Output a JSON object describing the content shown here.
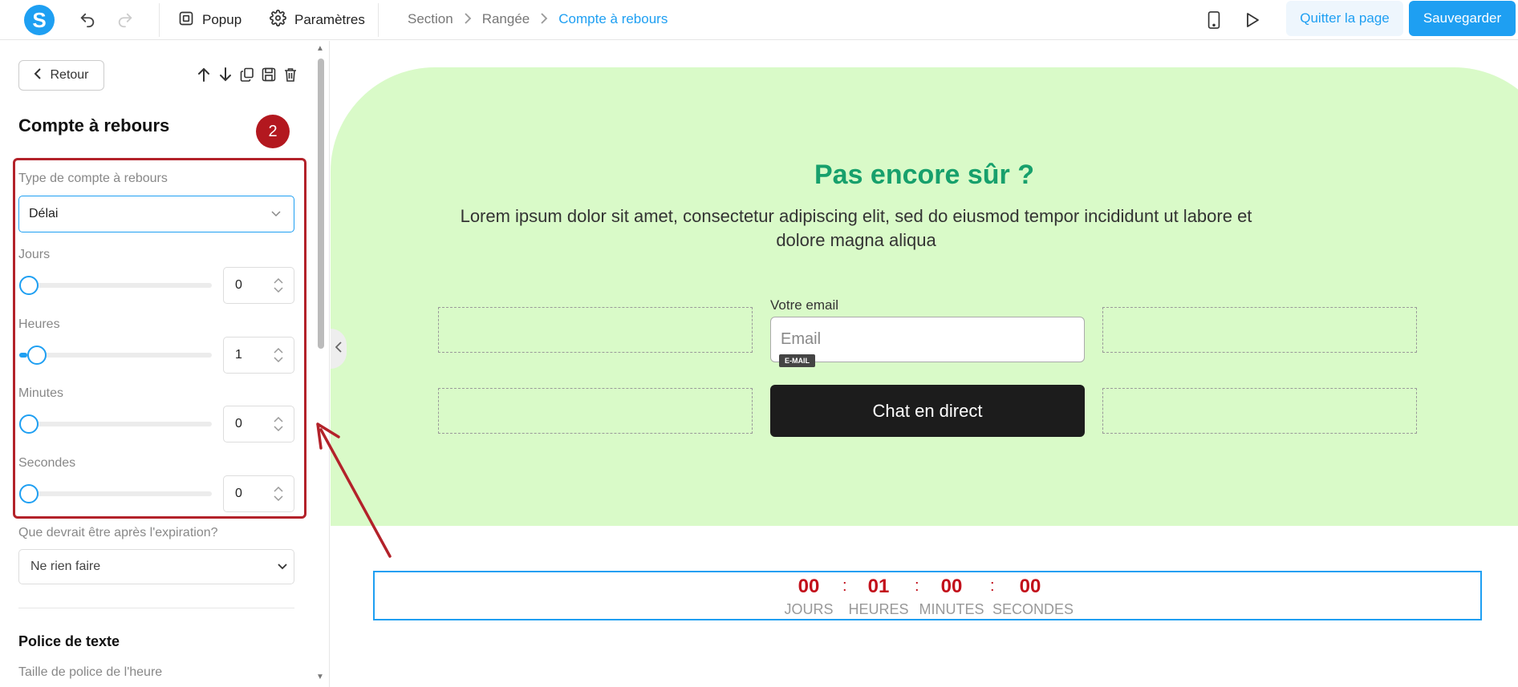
{
  "app": {
    "logo_letter": "S",
    "brand_color": "#1e9ff2"
  },
  "toolbar": {
    "popup_label": "Popup",
    "settings_label": "Paramètres",
    "quit_label": "Quitter la page",
    "save_label": "Sauvegarder"
  },
  "breadcrumb": {
    "items": [
      "Section",
      "Rangée",
      "Compte à rebours"
    ]
  },
  "panel": {
    "back_label": "Retour",
    "title": "Compte à rebours",
    "step_badge": "2",
    "type_label": "Type de compte à rebours",
    "type_value": "Délai",
    "fields": [
      {
        "label": "Jours",
        "value": "0",
        "slider_fraction": 0.0
      },
      {
        "label": "Heures",
        "value": "1",
        "slider_fraction": 0.04
      },
      {
        "label": "Minutes",
        "value": "0",
        "slider_fraction": 0.0
      },
      {
        "label": "Secondes",
        "value": "0",
        "slider_fraction": 0.0
      }
    ],
    "expiry_label": "Que devrait être après l'expiration?",
    "expiry_value": "Ne rien faire",
    "font_section_title": "Police de texte",
    "font_size_label": "Taille de police de l'heure"
  },
  "canvas": {
    "headline": "Pas encore sûr ?",
    "body": "Lorem ipsum dolor sit amet, consectetur adipiscing elit, sed do eiusmod tempor incididunt ut labore et dolore magna aliqua",
    "email_label": "Votre email",
    "email_placeholder": "Email",
    "email_tag": "E-MAIL",
    "cta_label": "Chat en direct",
    "background_color": "#d9fac8",
    "headline_color": "#17a06c"
  },
  "countdown": {
    "units": [
      {
        "value": "00",
        "label": "JOURS"
      },
      {
        "value": "01",
        "label": "HEURES"
      },
      {
        "value": "00",
        "label": "MINUTES"
      },
      {
        "value": "00",
        "label": "SECONDES"
      }
    ],
    "separator": ":",
    "number_color": "#c2101b"
  }
}
